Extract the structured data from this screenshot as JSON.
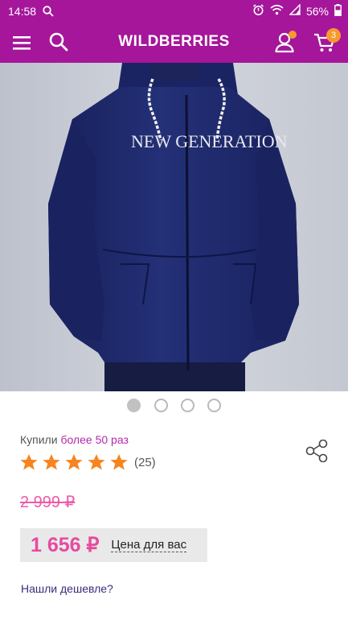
{
  "status_bar": {
    "time": "14:58",
    "battery": "56%",
    "icons": [
      "search-icon",
      "alarm-icon",
      "wifi-icon",
      "signal-icon",
      "battery-icon"
    ]
  },
  "app_bar": {
    "brand": "WILDBERRIES",
    "cart_count": "3",
    "icons": [
      "menu-icon",
      "search-icon",
      "user-icon",
      "cart-icon"
    ]
  },
  "product": {
    "image_print": "NEW GENERATION",
    "carousel": {
      "total": 4,
      "active": 1
    },
    "bought_prefix": "Купили",
    "bought_value": "более 50 раз",
    "rating": {
      "stars": 5,
      "max": 5,
      "count": "(25)"
    },
    "old_price": "2 999 ₽",
    "price": "1 656 ₽",
    "price_label": "Цена для вас",
    "cheaper_link": "Нашли дешевле?"
  },
  "colors": {
    "brand_purple": "#a5169a",
    "badge_orange": "#f7992d",
    "star_orange": "#f7841e",
    "price_pink": "#e64aa0",
    "jacket_navy": "#1d2666"
  }
}
